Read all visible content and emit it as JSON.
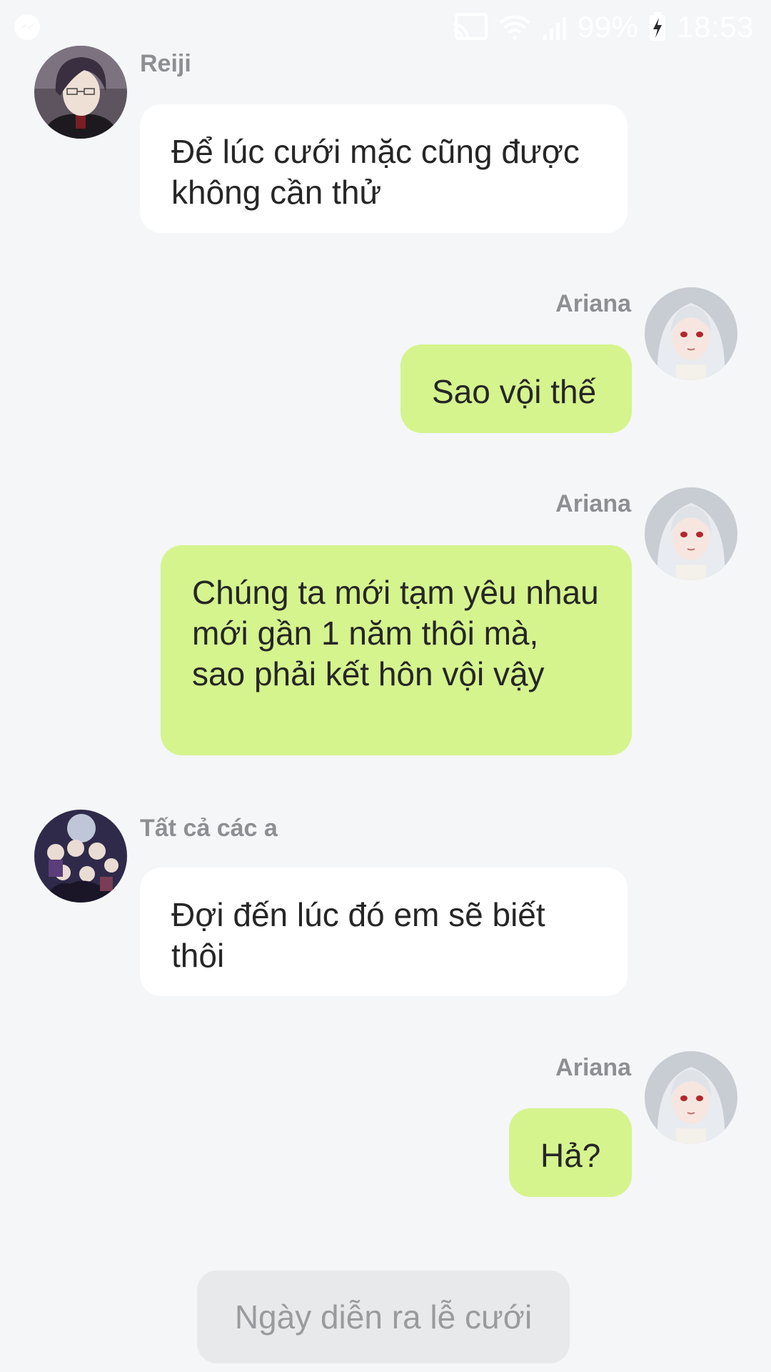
{
  "status_bar": {
    "battery_percent": "99%",
    "time": "18:53",
    "icons": [
      "messenger-icon",
      "cast-icon",
      "wifi-icon",
      "signal-icon",
      "battery-charging-icon"
    ]
  },
  "messages": [
    {
      "sender": "Reiji",
      "side": "left",
      "avatar": "reiji-avatar",
      "text": "Để lúc cưới mặc cũng được không cần thử"
    },
    {
      "sender": "Ariana",
      "side": "right",
      "avatar": "ariana-avatar",
      "text": "Sao vội thế"
    },
    {
      "sender": "Ariana",
      "side": "right",
      "avatar": "ariana-avatar",
      "text": "Chúng ta mới tạm yêu nhau mới gần 1 năm thôi mà, sao phải kết hôn vội vậy"
    },
    {
      "sender": "Tất cả các a",
      "side": "left",
      "avatar": "group-avatar",
      "text": "Đợi đến lúc đó em sẽ biết thôi"
    },
    {
      "sender": "Ariana",
      "side": "right",
      "avatar": "ariana-avatar",
      "text": "Hả?"
    }
  ],
  "choice": {
    "label": "Ngày diễn ra lễ cưới"
  },
  "colors": {
    "background": "#f4f6f8",
    "incoming_bubble": "#ffffff",
    "outgoing_bubble": "#d5f48e",
    "sender_name": "#8d8f93",
    "choice_button_bg": "#e8e9eb",
    "choice_button_text": "#9a9b9e"
  }
}
